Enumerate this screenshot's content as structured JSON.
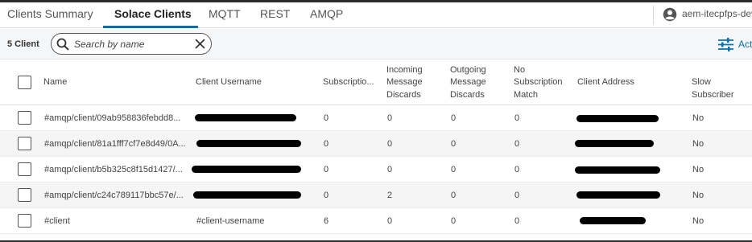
{
  "tabs": [
    {
      "label": "Clients Summary"
    },
    {
      "label": "Solace Clients"
    },
    {
      "label": "MQTT"
    },
    {
      "label": "REST"
    },
    {
      "label": "AMQP"
    }
  ],
  "user": {
    "label": "aem-itecpfps-dev",
    "icon": "account-circle-icon"
  },
  "toolbar": {
    "count_label": "5 Client",
    "search_placeholder": "Search by name",
    "actions_label": "Act"
  },
  "table": {
    "columns": [
      {
        "label": "Name"
      },
      {
        "label": "Client Username"
      },
      {
        "label": "Subscriptio..."
      },
      {
        "label_lines": [
          "Incoming",
          "Message",
          "Discards"
        ]
      },
      {
        "label_lines": [
          "Outgoing",
          "Message",
          "Discards"
        ]
      },
      {
        "label_lines": [
          "No",
          "Subscription",
          "Match"
        ]
      },
      {
        "label": "Client Address"
      },
      {
        "label_lines": [
          "Slow",
          "Subscriber"
        ]
      }
    ],
    "rows": [
      {
        "name": "#amqp/client/09ab958836febdd8...",
        "username": "",
        "subscriptions": "0",
        "incoming": "0",
        "outgoing": "0",
        "no_match": "0",
        "address": "",
        "slow": "No"
      },
      {
        "name": "#amqp/client/81a1fff7cf7e8d49/0A...",
        "username": "",
        "subscriptions": "0",
        "incoming": "0",
        "outgoing": "0",
        "no_match": "0",
        "address": "",
        "slow": "No"
      },
      {
        "name": "#amqp/client/b5b325c8f15d1427/...",
        "username": "",
        "subscriptions": "0",
        "incoming": "0",
        "outgoing": "0",
        "no_match": "0",
        "address": "",
        "slow": "No"
      },
      {
        "name": "#amqp/client/c24c789117bbc57e/...",
        "username": "",
        "subscriptions": "0",
        "incoming": "2",
        "outgoing": "0",
        "no_match": "0",
        "address": "",
        "slow": "No"
      },
      {
        "name": "#client",
        "username": "#client-username",
        "subscriptions": "6",
        "incoming": "0",
        "outgoing": "0",
        "no_match": "0",
        "address": "",
        "slow": "No"
      }
    ]
  },
  "colors": {
    "accent": "#0b6fa8",
    "row_alt": "#f5f5f5",
    "redaction": "#000000"
  }
}
